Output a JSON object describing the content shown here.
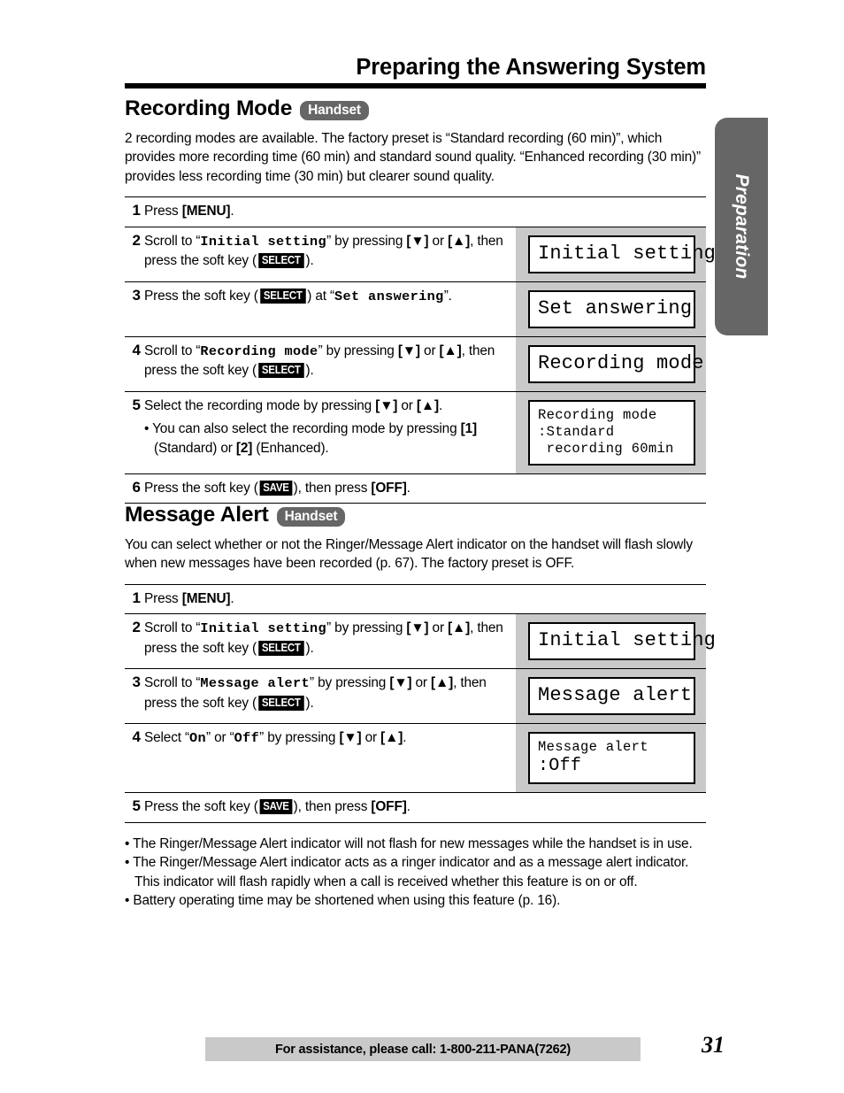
{
  "running_head": "Preparing the Answering System",
  "side_tab": {
    "label": "Preparation"
  },
  "sections": [
    {
      "id": "recording-mode",
      "title": "Recording Mode",
      "badge": "Handset",
      "intro": "2 recording modes are available. The factory preset is “Standard recording (60 min)”, which provides more recording time (60 min) and standard sound quality. “Enhanced recording (30 min)” provides less recording time (30 min) but clearer sound quality.",
      "steps": [
        {
          "num": "1",
          "parts": [
            {
              "t": "plain",
              "v": "Press "
            },
            {
              "t": "bold",
              "v": "[MENU]"
            },
            {
              "t": "plain",
              "v": "."
            }
          ],
          "display": null
        },
        {
          "num": "2",
          "parts": [
            {
              "t": "plain",
              "v": "Scroll to “"
            },
            {
              "t": "mono",
              "v": "Initial setting"
            },
            {
              "t": "plain",
              "v": "” by pressing "
            },
            {
              "t": "bold",
              "v": "[▼]"
            },
            {
              "t": "plain",
              "v": " or "
            },
            {
              "t": "bold",
              "v": "[▲]"
            },
            {
              "t": "plain",
              "v": ", then press the soft key ("
            },
            {
              "t": "softkey",
              "v": "SELECT"
            },
            {
              "t": "plain",
              "v": ")."
            }
          ],
          "display": {
            "size": "big",
            "lines": [
              "Initial setting"
            ]
          }
        },
        {
          "num": "3",
          "parts": [
            {
              "t": "plain",
              "v": "Press the soft key ("
            },
            {
              "t": "softkey",
              "v": "SELECT"
            },
            {
              "t": "plain",
              "v": ") at “"
            },
            {
              "t": "mono",
              "v": "Set answering"
            },
            {
              "t": "plain",
              "v": "”."
            }
          ],
          "display": {
            "size": "big",
            "lines": [
              "Set answering"
            ]
          }
        },
        {
          "num": "4",
          "parts": [
            {
              "t": "plain",
              "v": "Scroll to “"
            },
            {
              "t": "mono",
              "v": "Recording mode"
            },
            {
              "t": "plain",
              "v": "” by pressing "
            },
            {
              "t": "bold",
              "v": "[▼]"
            },
            {
              "t": "plain",
              "v": " or "
            },
            {
              "t": "bold",
              "v": "[▲]"
            },
            {
              "t": "plain",
              "v": ", then press the soft key ("
            },
            {
              "t": "softkey",
              "v": "SELECT"
            },
            {
              "t": "plain",
              "v": ")."
            }
          ],
          "display": {
            "size": "big",
            "lines": [
              "Recording mode"
            ]
          }
        },
        {
          "num": "5",
          "parts": [
            {
              "t": "plain",
              "v": "Select the recording mode by pressing "
            },
            {
              "t": "bold",
              "v": "[▼]"
            },
            {
              "t": "plain",
              "v": " or "
            },
            {
              "t": "bold",
              "v": "[▲]"
            },
            {
              "t": "plain",
              "v": "."
            }
          ],
          "sub_parts": [
            {
              "t": "plain",
              "v": "• You can also select the recording mode by pressing "
            },
            {
              "t": "bold",
              "v": "[1]"
            },
            {
              "t": "plain",
              "v": " (Standard) or "
            },
            {
              "t": "bold",
              "v": "[2]"
            },
            {
              "t": "plain",
              "v": " (Enhanced)."
            }
          ],
          "display": {
            "size": "small",
            "lines": [
              "Recording mode",
              ":Standard",
              " recording 60min"
            ]
          }
        },
        {
          "num": "6",
          "parts": [
            {
              "t": "plain",
              "v": "Press the soft key ("
            },
            {
              "t": "softkey",
              "v": "SAVE"
            },
            {
              "t": "plain",
              "v": "), then press "
            },
            {
              "t": "bold",
              "v": "[OFF]"
            },
            {
              "t": "plain",
              "v": "."
            }
          ],
          "display": null
        }
      ]
    },
    {
      "id": "message-alert",
      "title": "Message Alert",
      "badge": "Handset",
      "intro": "You can select whether or not the Ringer/Message Alert indicator on the handset will flash slowly when new messages have been recorded (p. 67). The factory preset is OFF.",
      "steps": [
        {
          "num": "1",
          "parts": [
            {
              "t": "plain",
              "v": "Press "
            },
            {
              "t": "bold",
              "v": "[MENU]"
            },
            {
              "t": "plain",
              "v": "."
            }
          ],
          "display": null
        },
        {
          "num": "2",
          "parts": [
            {
              "t": "plain",
              "v": "Scroll to “"
            },
            {
              "t": "mono",
              "v": "Initial setting"
            },
            {
              "t": "plain",
              "v": "” by pressing "
            },
            {
              "t": "bold",
              "v": "[▼]"
            },
            {
              "t": "plain",
              "v": " or "
            },
            {
              "t": "bold",
              "v": "[▲]"
            },
            {
              "t": "plain",
              "v": ", then press the soft key ("
            },
            {
              "t": "softkey",
              "v": "SELECT"
            },
            {
              "t": "plain",
              "v": ")."
            }
          ],
          "display": {
            "size": "big",
            "lines": [
              "Initial setting"
            ]
          }
        },
        {
          "num": "3",
          "parts": [
            {
              "t": "plain",
              "v": "Scroll to “"
            },
            {
              "t": "mono",
              "v": "Message alert"
            },
            {
              "t": "plain",
              "v": "” by pressing "
            },
            {
              "t": "bold",
              "v": "[▼]"
            },
            {
              "t": "plain",
              "v": " or "
            },
            {
              "t": "bold",
              "v": "[▲]"
            },
            {
              "t": "plain",
              "v": ", then press the soft key ("
            },
            {
              "t": "softkey",
              "v": "SELECT"
            },
            {
              "t": "plain",
              "v": ")."
            }
          ],
          "display": {
            "size": "big",
            "lines": [
              "Message alert"
            ]
          }
        },
        {
          "num": "4",
          "parts": [
            {
              "t": "plain",
              "v": "Select “"
            },
            {
              "t": "mono",
              "v": "On"
            },
            {
              "t": "plain",
              "v": "” or “"
            },
            {
              "t": "mono",
              "v": "Off"
            },
            {
              "t": "plain",
              "v": "” by pressing "
            },
            {
              "t": "bold",
              "v": "[▼]"
            },
            {
              "t": "plain",
              "v": " or "
            },
            {
              "t": "bold",
              "v": "[▲]"
            },
            {
              "t": "plain",
              "v": "."
            }
          ],
          "display": {
            "size": "mixed",
            "lines": [
              "Message alert",
              ":Off"
            ]
          }
        },
        {
          "num": "5",
          "parts": [
            {
              "t": "plain",
              "v": "Press the soft key ("
            },
            {
              "t": "softkey",
              "v": "SAVE"
            },
            {
              "t": "plain",
              "v": "), then press "
            },
            {
              "t": "bold",
              "v": "[OFF]"
            },
            {
              "t": "plain",
              "v": "."
            }
          ],
          "display": null
        }
      ]
    }
  ],
  "notes": [
    "• The Ringer/Message Alert indicator will not flash for new messages while the handset is in use.",
    "• The Ringer/Message Alert indicator acts as a ringer indicator and as a message alert indicator. This indicator will flash rapidly when a call is received whether this feature is on or off.",
    "• Battery operating time may be shortened when using this feature (p. 16)."
  ],
  "footer": {
    "assistance": "For assistance, please call: 1-800-211-PANA(7262)",
    "page_number": "31"
  },
  "colors": {
    "tab_gray": "#666666",
    "panel_gray": "#c9c9c9",
    "ink": "#000000"
  }
}
